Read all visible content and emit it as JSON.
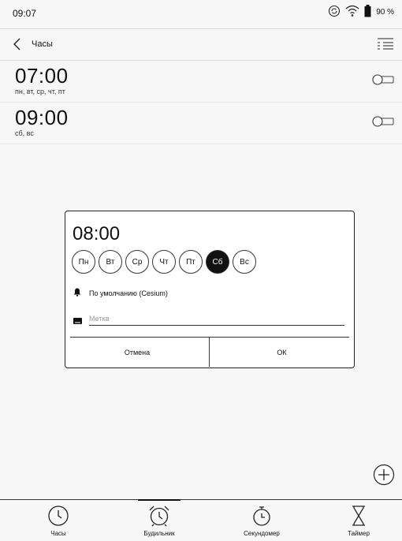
{
  "status_bar": {
    "time": "09:07",
    "battery": "90 %",
    "icons": [
      "sync-icon",
      "wifi-icon",
      "battery-icon"
    ]
  },
  "app_bar": {
    "title": "Часы"
  },
  "alarms": [
    {
      "time": "07:00",
      "days": "пн, вт, ср, чт, пт",
      "enabled": false
    },
    {
      "time": "09:00",
      "days": "сб, вс",
      "enabled": false
    }
  ],
  "dialog": {
    "time": "08:00",
    "weekdays": [
      {
        "label": "Пн",
        "selected": false
      },
      {
        "label": "Вт",
        "selected": false
      },
      {
        "label": "Ср",
        "selected": false
      },
      {
        "label": "Чт",
        "selected": false
      },
      {
        "label": "Пт",
        "selected": false
      },
      {
        "label": "Сб",
        "selected": true
      },
      {
        "label": "Вс",
        "selected": false
      }
    ],
    "sound": "По умолчанию (Cesium)",
    "label_placeholder": "Метка",
    "label_value": "",
    "cancel_label": "Отмена",
    "ok_label": "ОК"
  },
  "bottom_nav": [
    {
      "label": "Часы",
      "icon": "clock-icon",
      "active": false
    },
    {
      "label": "Будильник",
      "icon": "alarm-clock-icon",
      "active": true
    },
    {
      "label": "Секундомер",
      "icon": "stopwatch-icon",
      "active": false
    },
    {
      "label": "Таймер",
      "icon": "hourglass-icon",
      "active": false
    }
  ],
  "colors": {
    "background": "#f7f7f7",
    "foreground": "#111111",
    "selected_day": "#111111"
  }
}
